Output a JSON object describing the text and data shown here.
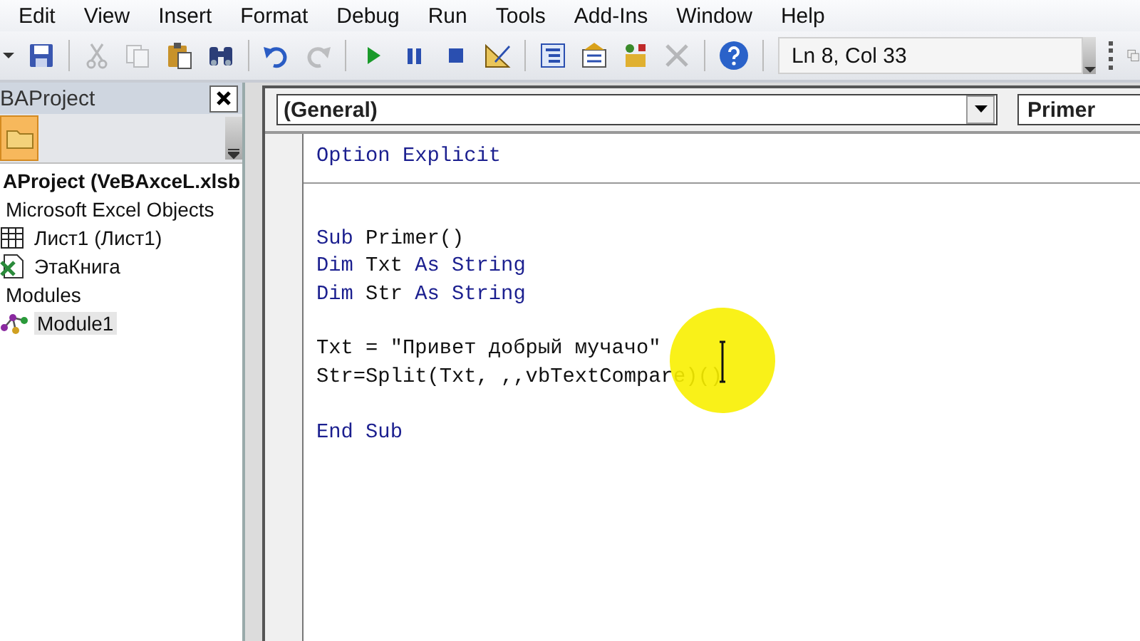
{
  "menu": [
    {
      "label": "Edit"
    },
    {
      "label": "View"
    },
    {
      "label": "Insert"
    },
    {
      "label": "Format"
    },
    {
      "label": "Debug"
    },
    {
      "label": "Run"
    },
    {
      "label": "Tools"
    },
    {
      "label": "Add-Ins"
    },
    {
      "label": "Window"
    },
    {
      "label": "Help"
    }
  ],
  "toolbar": [
    {
      "kind": "caret"
    },
    {
      "kind": "save",
      "disabled": false
    },
    {
      "kind": "sep"
    },
    {
      "kind": "cut",
      "disabled": true
    },
    {
      "kind": "copy",
      "disabled": true
    },
    {
      "kind": "paste",
      "disabled": false
    },
    {
      "kind": "find",
      "disabled": false
    },
    {
      "kind": "sep"
    },
    {
      "kind": "undo",
      "disabled": false
    },
    {
      "kind": "redo",
      "disabled": true
    },
    {
      "kind": "sep"
    },
    {
      "kind": "run",
      "disabled": false
    },
    {
      "kind": "pause",
      "disabled": false
    },
    {
      "kind": "stop",
      "disabled": false
    },
    {
      "kind": "design",
      "disabled": false
    },
    {
      "kind": "sep"
    },
    {
      "kind": "explorer",
      "disabled": false
    },
    {
      "kind": "properties",
      "disabled": false
    },
    {
      "kind": "browser",
      "disabled": false
    },
    {
      "kind": "tools",
      "disabled": true
    },
    {
      "kind": "sep"
    },
    {
      "kind": "help",
      "disabled": false
    }
  ],
  "status": {
    "position": "Ln 8, Col 33"
  },
  "project_panel": {
    "title": "BAProject",
    "tree": [
      {
        "label": "AProject (VeBAxceL.xlsb",
        "kind": "project",
        "children": [
          {
            "label": "Microsoft Excel Objects",
            "kind": "folder",
            "children": [
              {
                "label": "Лист1 (Лист1)",
                "kind": "sheet",
                "selected": false
              },
              {
                "label": "ЭтаКнига",
                "kind": "workbook",
                "selected": false
              }
            ]
          },
          {
            "label": "Modules",
            "kind": "folder",
            "children": [
              {
                "label": "Module1",
                "kind": "module",
                "selected": true
              }
            ]
          }
        ]
      }
    ]
  },
  "code_window": {
    "object": "(General)",
    "procedure": "Primer",
    "lines": [
      {
        "kind": "code",
        "tokens": [
          {
            "text": "Option Explicit",
            "keyword": true
          }
        ]
      },
      {
        "kind": "divider"
      },
      {
        "kind": "blank"
      },
      {
        "kind": "code",
        "tokens": [
          {
            "text": "Sub",
            "keyword": true
          },
          {
            "text": " Primer()",
            "keyword": false
          }
        ]
      },
      {
        "kind": "code",
        "tokens": [
          {
            "text": "Dim",
            "keyword": true
          },
          {
            "text": " Txt ",
            "keyword": false
          },
          {
            "text": "As String",
            "keyword": true
          }
        ]
      },
      {
        "kind": "code",
        "tokens": [
          {
            "text": "Dim",
            "keyword": true
          },
          {
            "text": " Str ",
            "keyword": false
          },
          {
            "text": "As String",
            "keyword": true
          }
        ]
      },
      {
        "kind": "blank"
      },
      {
        "kind": "code",
        "tokens": [
          {
            "text": "Txt = \"Привет добрый мучачо\"",
            "keyword": false
          }
        ]
      },
      {
        "kind": "code",
        "tokens": [
          {
            "text": "Str=Split(Txt, ,,vbTextCompare)()",
            "keyword": false
          }
        ]
      },
      {
        "kind": "blank"
      },
      {
        "kind": "code",
        "tokens": [
          {
            "text": "End Sub",
            "keyword": true
          }
        ]
      }
    ]
  }
}
